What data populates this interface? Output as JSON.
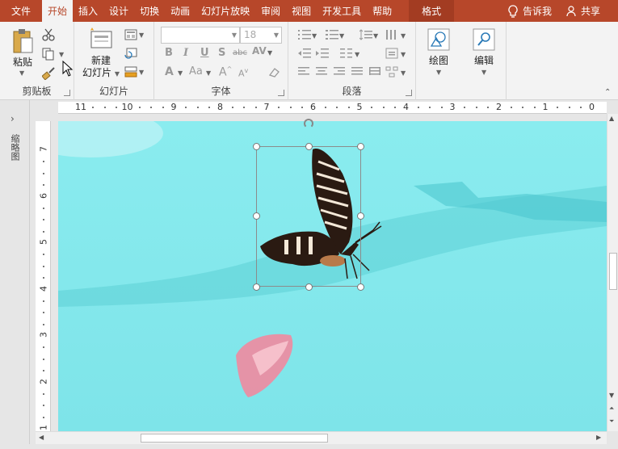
{
  "tabs": [
    {
      "label": "文件",
      "active": false
    },
    {
      "label": "开始",
      "active": true
    },
    {
      "label": "插入",
      "active": false
    },
    {
      "label": "设计",
      "active": false
    },
    {
      "label": "切换",
      "active": false
    },
    {
      "label": "动画",
      "active": false
    },
    {
      "label": "幻灯片放映",
      "active": false
    },
    {
      "label": "审阅",
      "active": false
    },
    {
      "label": "视图",
      "active": false
    },
    {
      "label": "开发工具",
      "active": false
    },
    {
      "label": "帮助",
      "active": false
    }
  ],
  "context_tab": "格式",
  "tell_me": "告诉我",
  "share": "共享",
  "ribbon": {
    "clipboard": {
      "paste": "粘贴",
      "label": "剪贴板"
    },
    "slides": {
      "new_line1": "新建",
      "new_line2": "幻灯片",
      "label": "幻灯片"
    },
    "font": {
      "size": "18",
      "label": "字体"
    },
    "paragraph": {
      "label": "段落"
    },
    "drawing": {
      "label": "绘图"
    },
    "editing": {
      "label": "编辑"
    }
  },
  "thumbnail_pane_title": "缩略图",
  "ruler_h": [
    "11",
    "10",
    "9",
    "8",
    "7",
    "6",
    "5",
    "4",
    "3",
    "2",
    "1",
    "0"
  ],
  "ruler_v": [
    "7",
    "6",
    "5",
    "4",
    "3",
    "2",
    "1"
  ],
  "colors": {
    "accent": "#b7472a",
    "slide_bg": "#7fe6ea"
  }
}
